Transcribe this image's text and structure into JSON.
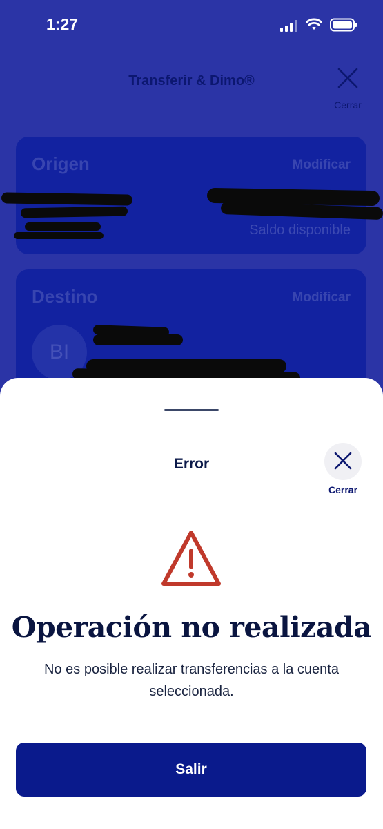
{
  "status_bar": {
    "time": "1:27"
  },
  "header": {
    "title": "Transferir & Dimo®",
    "close_label": "Cerrar"
  },
  "origin_card": {
    "title": "Origen",
    "modify_label": "Modificar",
    "balance_label": "Saldo disponible"
  },
  "destination_card": {
    "title": "Destino",
    "modify_label": "Modificar",
    "avatar_initials": "BI"
  },
  "error_sheet": {
    "title": "Error",
    "close_label": "Cerrar",
    "headline": "Operación no realizada",
    "message": "No es posible realizar transferencias a la cuenta seleccionada.",
    "exit_label": "Salir"
  },
  "colors": {
    "primary": "#0a1a8c",
    "warning": "#c0392b",
    "background_overlay": "#2b34a6"
  }
}
